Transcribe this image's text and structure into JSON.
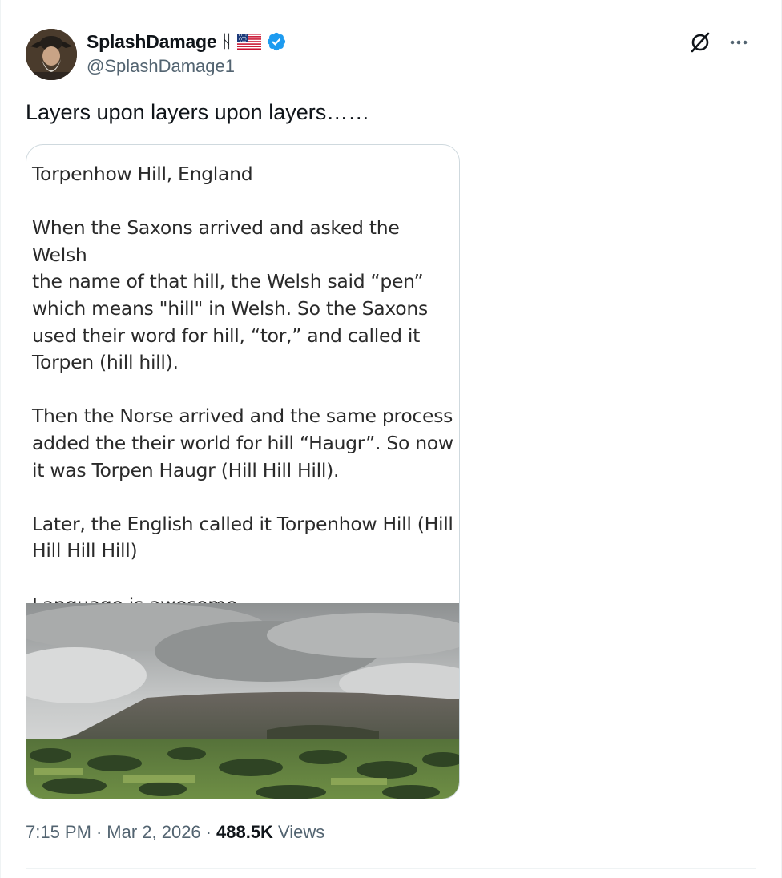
{
  "author": {
    "display_name": "SplashDamage",
    "rune": "ᚺ",
    "handle": "@SplashDamage1",
    "verified": true,
    "flag_icon": "us-flag-icon",
    "avatar_icon": "profile-avatar"
  },
  "tweet": {
    "text": "Layers upon layers upon layers……"
  },
  "media": {
    "paragraphs": [
      "Torpenhow Hill, England",
      "When the Saxons arrived and asked the Welsh\nthe name of that hill, the Welsh said “pen”\nwhich means \"hill\" in Welsh. So the Saxons\nused their word for hill, “tor,” and called it\nTorpen (hill hill).",
      "Then the Norse arrived and the same process\nadded the their world for hill “Haugr”. So now\nit was Torpen Haugr (Hill Hill Hill).",
      "Later, the English called it Torpenhow Hill (Hill\nHill Hill Hill)",
      "Language is awesome."
    ],
    "image_description_icon": "hill-landscape-photo"
  },
  "meta": {
    "time": "7:15 PM",
    "separator": "·",
    "date": "Mar 2, 2026",
    "views_count": "488.5K",
    "views_label": "Views"
  },
  "icons": {
    "grok": "grok-icon",
    "more": "more-options-icon"
  },
  "colors": {
    "verified_blue": "#1d9bf0",
    "secondary_text": "#536471",
    "primary_text": "#0f1419"
  }
}
